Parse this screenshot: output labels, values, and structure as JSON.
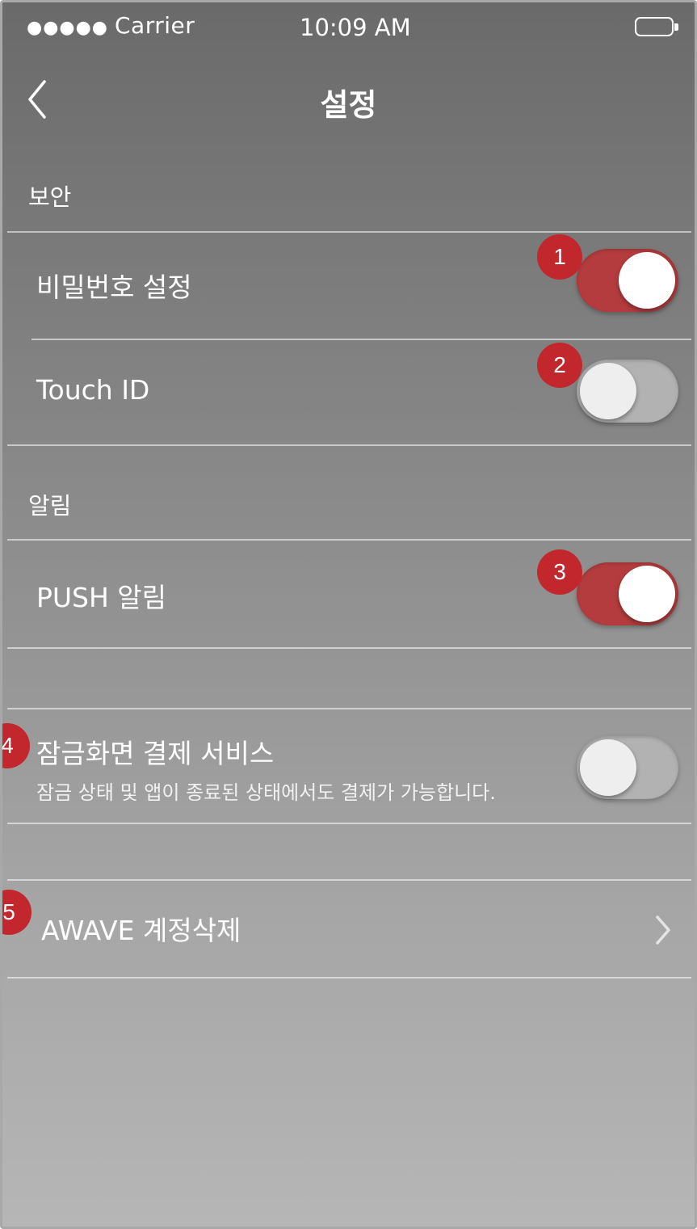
{
  "status_bar": {
    "carrier_dots": "●●●●●",
    "carrier": "Carrier",
    "time": "10:09 AM",
    "battery_icon": "battery-icon"
  },
  "nav": {
    "title": "설정",
    "back_icon": "chevron-left-icon"
  },
  "sections": {
    "security": {
      "header": "보안",
      "items": [
        {
          "label": "비밀번호 설정",
          "toggle": "on",
          "badge": "1"
        },
        {
          "label": "Touch ID",
          "toggle": "off",
          "badge": "2"
        }
      ]
    },
    "notifications": {
      "header": "알림",
      "items": [
        {
          "label": "PUSH 알림",
          "toggle": "on",
          "badge": "3"
        }
      ]
    },
    "lockscreen": {
      "label": "잠금화면 결제 서비스",
      "sub": "잠금 상태 및 앱이 종료된 상태에서도 결제가 가능합니다.",
      "toggle": "off",
      "badge": "4"
    },
    "account": {
      "label": "AWAVE 계정삭제",
      "badge": "5",
      "chevron_icon": "chevron-right-icon"
    }
  },
  "colors": {
    "toggle_on": "#b43c3e",
    "toggle_off": "#b2b2b2",
    "badge": "#c1272d"
  }
}
